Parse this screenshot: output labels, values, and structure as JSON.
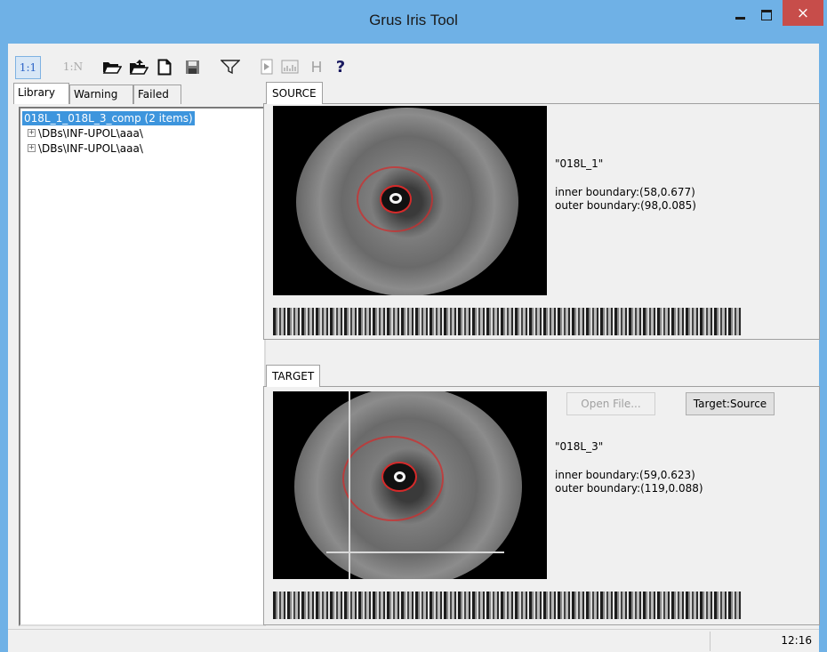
{
  "window": {
    "title": "Grus Iris Tool",
    "close_glyph": "×"
  },
  "toolbar": {
    "one_to_one": "1:1",
    "one_to_n": "1:N",
    "help": "?",
    "icons": [
      "open-folder-icon",
      "open-folder-up-icon",
      "new-document-icon",
      "save-icon",
      "filter-icon",
      "play-icon",
      "histogram-icon",
      "h-icon",
      "help-icon"
    ]
  },
  "left_tabs": [
    "Library",
    "Warning",
    "Failed"
  ],
  "tree": {
    "root": "018L_1_018L_3_comp (2 items)",
    "items": [
      "\\DBs\\INF-UPOL\\aaa\\",
      "\\DBs\\INF-UPOL\\aaa\\"
    ]
  },
  "source": {
    "tab": "SOURCE",
    "name": "\"018L_1\"",
    "inner": "inner boundary:(58,0.677)",
    "outer": "outer boundary:(98,0.085)"
  },
  "target": {
    "tab": "TARGET",
    "open_file": "Open File...",
    "target_source": "Target:Source",
    "name": "\"018L_3\"",
    "inner": "inner boundary:(59,0.623)",
    "outer": "outer boundary:(119,0.088)"
  },
  "status": {
    "time": "12:16"
  },
  "colors": {
    "titlebar": "#6fb1e6",
    "close": "#c74d4a",
    "selection": "#3d95dd",
    "ring": "#d62a2a"
  }
}
